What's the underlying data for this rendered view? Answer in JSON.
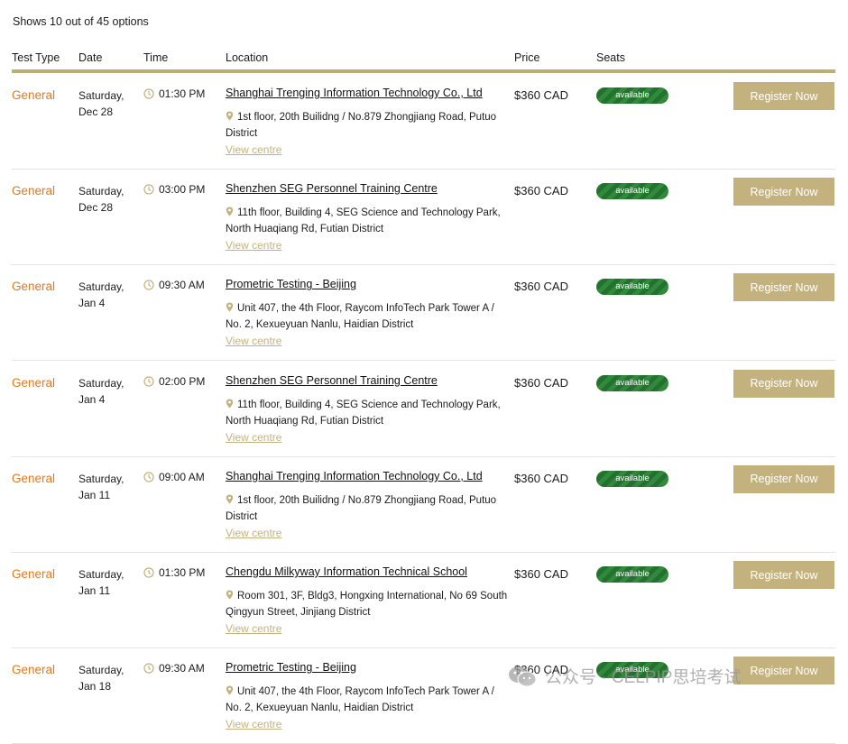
{
  "summary": "Shows 10 out of 45 options",
  "headers": {
    "test_type": "Test Type",
    "date": "Date",
    "time": "Time",
    "location": "Location",
    "price": "Price",
    "seats": "Seats"
  },
  "rows": [
    {
      "type": "General",
      "date_day": "Saturday,",
      "date_md": "Dec 28",
      "time": "01:30 PM",
      "location": "Shanghai Trenging Information Technology Co., Ltd",
      "address": "1st floor, 20th Builidng / No.879 Zhongjiang Road, Putuo District",
      "view": "View centre",
      "price": "$360 CAD",
      "seats": "available",
      "register": "Register Now"
    },
    {
      "type": "General",
      "date_day": "Saturday,",
      "date_md": "Dec 28",
      "time": "03:00 PM",
      "location": "Shenzhen SEG Personnel Training Centre",
      "address": "11th floor, Building 4, SEG Science and Technology Park, North Huaqiang Rd, Futian District",
      "view": "View centre",
      "price": "$360 CAD",
      "seats": "available",
      "register": "Register Now"
    },
    {
      "type": "General",
      "date_day": "Saturday,",
      "date_md": "Jan 4",
      "time": "09:30 AM",
      "location": "Prometric Testing - Beijing",
      "address": "Unit 407, the 4th Floor, Raycom InfoTech Park Tower A / No. 2, Kexueyuan Nanlu, Haidian District",
      "view": "View centre",
      "price": "$360 CAD",
      "seats": "available",
      "register": "Register Now"
    },
    {
      "type": "General",
      "date_day": "Saturday,",
      "date_md": "Jan 4",
      "time": "02:00 PM",
      "location": "Shenzhen SEG Personnel Training Centre",
      "address": "11th floor, Building 4, SEG Science and Technology Park, North Huaqiang Rd, Futian District",
      "view": "View centre",
      "price": "$360 CAD",
      "seats": "available",
      "register": "Register Now"
    },
    {
      "type": "General",
      "date_day": "Saturday,",
      "date_md": "Jan 11",
      "time": "09:00 AM",
      "location": "Shanghai Trenging Information Technology Co., Ltd",
      "address": "1st floor, 20th Builidng / No.879 Zhongjiang Road, Putuo District",
      "view": "View centre",
      "price": "$360 CAD",
      "seats": "available",
      "register": "Register Now"
    },
    {
      "type": "General",
      "date_day": "Saturday,",
      "date_md": "Jan 11",
      "time": "01:30 PM",
      "location": "Chengdu Milkyway Information Technical School",
      "address": "Room 301, 3F, Bldg3, Hongxing International, No 69 South Qingyun Street, Jinjiang District",
      "view": "View centre",
      "price": "$360 CAD",
      "seats": "available",
      "register": "Register Now"
    },
    {
      "type": "General",
      "date_day": "Saturday,",
      "date_md": "Jan 18",
      "time": "09:30 AM",
      "location": "Prometric Testing - Beijing",
      "address": "Unit 407, the 4th Floor, Raycom InfoTech Park Tower A / No. 2, Kexueyuan Nanlu, Haidian District",
      "view": "View centre",
      "price": "$360 CAD",
      "seats": "available",
      "register": "Register Now"
    }
  ],
  "watermark": "公众号 · CELPIP思培考试",
  "colors": {
    "accent_gold": "#c4b27e",
    "test_type_orange": "#e07a1f",
    "available_green": "#2f8a3a"
  },
  "icons": {
    "time": "clock-icon",
    "address": "map-pin-icon",
    "watermark": "wechat-icon"
  }
}
